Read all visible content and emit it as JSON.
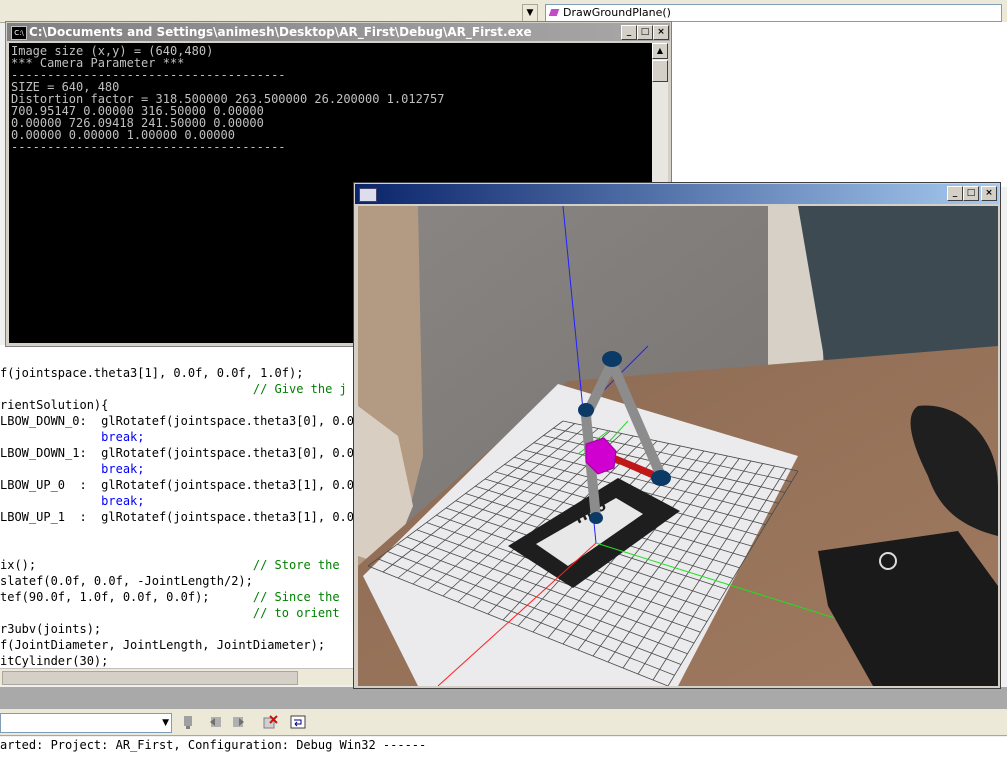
{
  "ide": {
    "member_dropdown": "DrawGroundPlane()",
    "code_lines": [
      {
        "text": "f(jointspace.theta3[1], 0.0f, 0.0f, 1.0f);",
        "kind": "code"
      },
      {
        "text": "                                   // Give the j",
        "kind": "comment"
      },
      {
        "text": "rientSolution){",
        "kind": "code"
      },
      {
        "text": "LBOW_DOWN_0:  glRotatef(jointspace.theta3[0], 0.0f,",
        "kind": "code"
      },
      {
        "text": "              break;",
        "kind": "keyword"
      },
      {
        "text": "LBOW_DOWN_1:  glRotatef(jointspace.theta3[0], 0.0f,",
        "kind": "code"
      },
      {
        "text": "              break;",
        "kind": "keyword"
      },
      {
        "text": "LBOW_UP_0  :  glRotatef(jointspace.theta3[1], 0.0f,",
        "kind": "code"
      },
      {
        "text": "              break;",
        "kind": "keyword"
      },
      {
        "text": "LBOW_UP_1  :  glRotatef(jointspace.theta3[1], 0.0f,",
        "kind": "code"
      },
      {
        "text": "",
        "kind": "code"
      },
      {
        "text": "",
        "kind": "code"
      },
      {
        "text": "ix();                              // Store the",
        "kind": "mixed"
      },
      {
        "text": "slatef(0.0f, 0.0f, -JointLength/2);",
        "kind": "code"
      },
      {
        "text": "tef(90.0f, 1.0f, 0.0f, 0.0f);      // Since the",
        "kind": "mixed"
      },
      {
        "text": "                                   // to orient",
        "kind": "comment"
      },
      {
        "text": "r3ubv(joints);",
        "kind": "code"
      },
      {
        "text": "f(JointDiameter, JointLength, JointDiameter);",
        "kind": "code"
      },
      {
        "text": "itCylinder(30);",
        "kind": "code"
      }
    ],
    "output_text": "arted: Project: AR_First, Configuration: Debug Win32 ------"
  },
  "console": {
    "title": "C:\\Documents and Settings\\animesh\\Desktop\\AR_First\\Debug\\AR_First.exe",
    "icon_label": "C:\\",
    "lines": [
      "Image size (x,y) = (640,480)",
      "*** Camera Parameter ***",
      "--------------------------------------",
      "SIZE = 640, 480",
      "Distortion factor = 318.500000 263.500000 26.200000 1.012757",
      "700.95147 0.00000 316.50000 0.00000",
      "0.00000 726.09418 241.50000 0.00000",
      "0.00000 0.00000 1.00000 0.00000",
      "--------------------------------------"
    ]
  },
  "camera_window": {
    "title": "",
    "marker_glyph": "Hiro",
    "grid_divisions": 20,
    "colors": {
      "x_axis": "#ff2020",
      "y_axis": "#20e020",
      "z_axis": "#2020ff",
      "end_effector": "#d000d0",
      "arm_link": "#8c8c8c",
      "joint": "#0c3a66",
      "title_start": "#0a246a",
      "title_end": "#a6caf0"
    }
  },
  "window_buttons": {
    "minimize": "_",
    "maximize": "□",
    "close": "×"
  }
}
